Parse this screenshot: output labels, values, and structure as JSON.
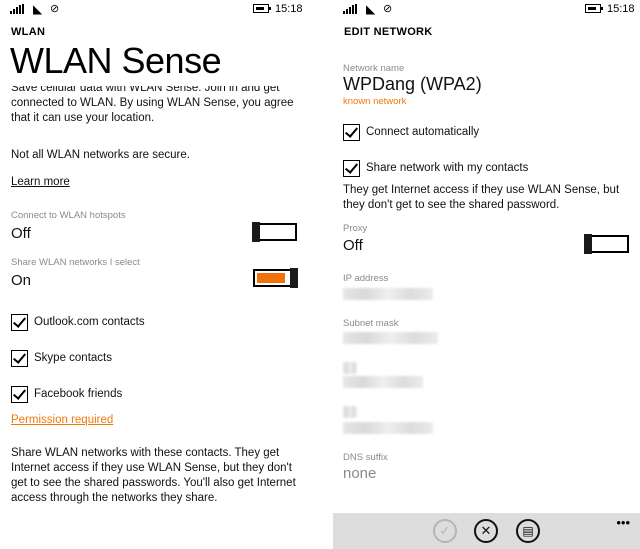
{
  "status_bar": {
    "wifi_icon": "wifi-icon",
    "mute_icon": "vibrate-off-icon",
    "time": "15:18"
  },
  "left": {
    "breadcrumb": "WLAN",
    "title": "WLAN Sense",
    "intro": "Save cellular data with WLAN Sense. Join in and get connected to WLAN. By using WLAN Sense, you agree that it can use your location.",
    "warning": "Not all WLAN networks are secure.",
    "learn_more": "Learn more",
    "hotspots": {
      "label": "Connect to WLAN hotspots",
      "value": "Off",
      "on": false
    },
    "share": {
      "label": "Share WLAN networks I select",
      "value": "On",
      "on": true
    },
    "contacts": [
      {
        "label": "Outlook.com contacts",
        "checked": true
      },
      {
        "label": "Skype contacts",
        "checked": true
      },
      {
        "label": "Facebook friends",
        "checked": true
      }
    ],
    "permission": "Permission required",
    "footer": "Share WLAN networks with these contacts. They get Internet access if they use WLAN Sense, but they don't get to see the shared passwords. You'll also get Internet access through the networks they share."
  },
  "right": {
    "breadcrumb": "EDIT NETWORK",
    "network_name_label": "Network name",
    "network_name": "WPDang (WPA2)",
    "known_network": "known network",
    "connect_auto": {
      "label": "Connect automatically",
      "checked": true
    },
    "share_contacts": {
      "label": "Share network with my contacts",
      "checked": true
    },
    "share_note": "They get Internet access if they use WLAN Sense, but they don't get to see the shared password.",
    "proxy": {
      "label": "Proxy",
      "value": "Off",
      "on": false
    },
    "ip_label": "IP address",
    "subnet_label": "Subnet mask",
    "dns_label": "DNS suffix",
    "dns_value": "none",
    "appbar": {
      "save_icon": "check-icon",
      "cancel_icon": "close-icon",
      "delete_icon": "trash-icon",
      "more": "•••"
    }
  },
  "colors": {
    "accent": "#f0720a",
    "link_orange": "#f0780a",
    "label_gray": "#8a8a8a",
    "appbar": "#dddddd"
  }
}
